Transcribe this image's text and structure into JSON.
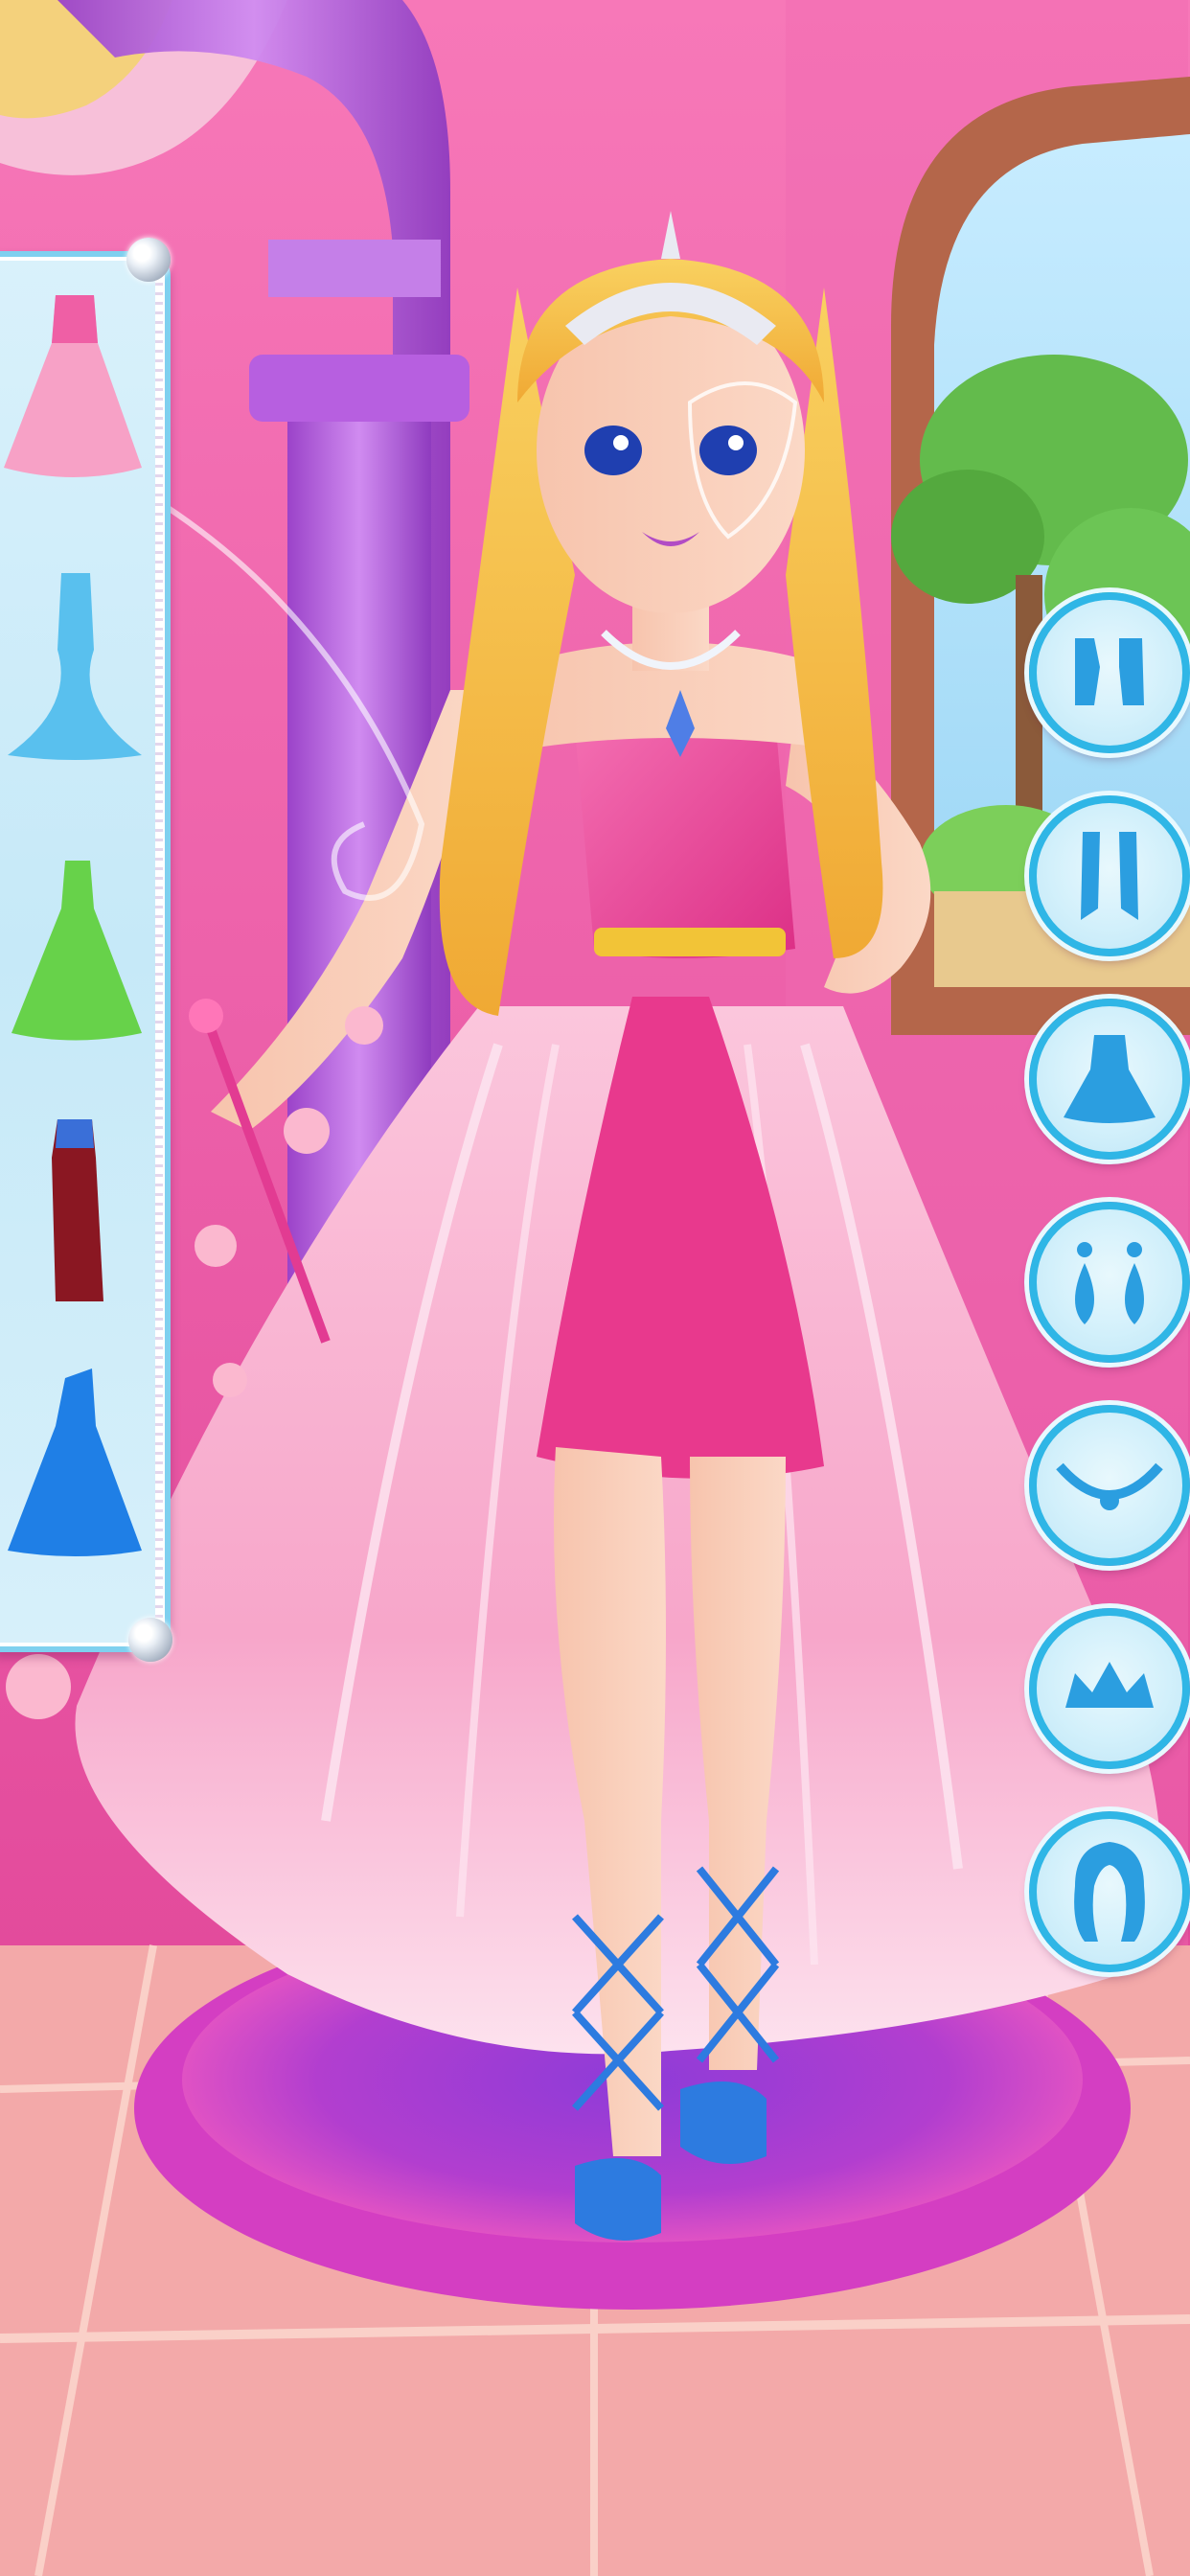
{
  "game": {
    "screen": "dress-up",
    "colors": {
      "wall": "#f05aa9",
      "arch": "#b45bd6",
      "floor": "#f3a9a9",
      "rug": "#d43ec2",
      "gown": "#f8a9cc",
      "bodice": "#ee4f9d",
      "hair": "#f6c64a",
      "panel": "#cdeefa",
      "button_ring": "#2fb6e6",
      "icon_blue": "#2b9ee0"
    }
  },
  "dress_panel": {
    "items": [
      {
        "name": "pink-ball-gown",
        "color": "#f7a1c6",
        "selected": true
      },
      {
        "name": "blue-mermaid-gown",
        "color": "#59c0ee",
        "selected": false
      },
      {
        "name": "green-gown",
        "color": "#67d24a",
        "selected": false
      },
      {
        "name": "dark-red-gown",
        "color": "#8a1722",
        "selected": false
      },
      {
        "name": "royal-blue-gown",
        "color": "#1f7fe6",
        "selected": false
      }
    ]
  },
  "categories": [
    {
      "name": "top",
      "icon": "shirt-icon"
    },
    {
      "name": "gloves",
      "icon": "gloves-icon"
    },
    {
      "name": "dress",
      "icon": "dress-icon"
    },
    {
      "name": "earrings",
      "icon": "earrings-icon"
    },
    {
      "name": "necklace",
      "icon": "necklace-icon"
    },
    {
      "name": "crown",
      "icon": "crown-icon"
    },
    {
      "name": "hair",
      "icon": "hair-icon"
    }
  ]
}
